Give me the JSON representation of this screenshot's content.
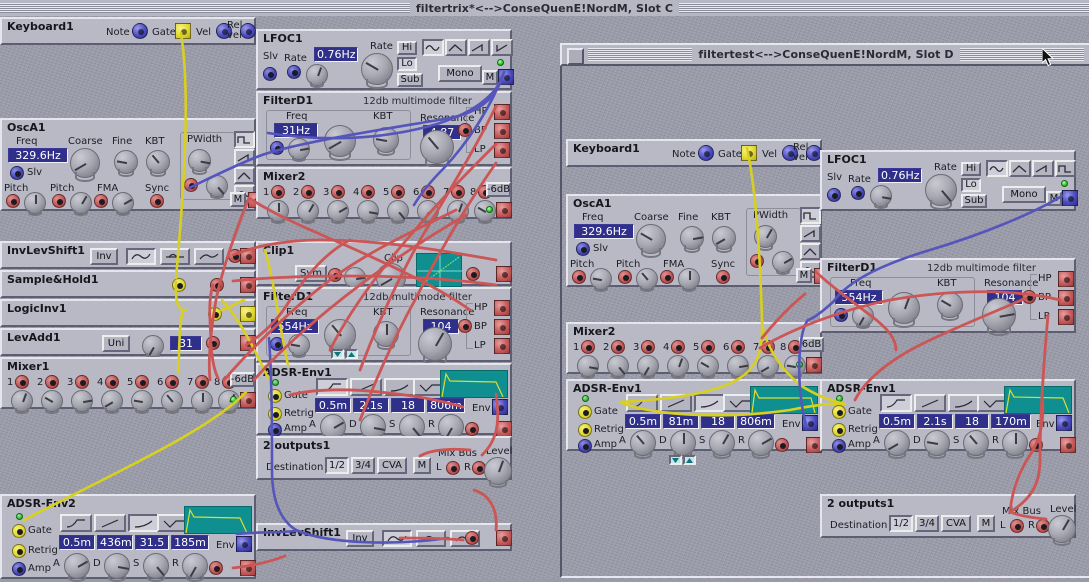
{
  "window_main": {
    "title": "filtertrix*<-->ConseQuenE!NordM, Slot C"
  },
  "window_sub": {
    "title": "filtertest<-->ConseQuenE!NordM, Slot D",
    "close_label": ""
  },
  "labels": {
    "note": "Note",
    "gate": "Gate",
    "vel": "Vel",
    "rel_vel": "Rel vel",
    "freq": "Freq",
    "coarse": "Coarse",
    "fine": "Fine",
    "kbt": "KBT",
    "pwidth": "PWidth",
    "pitch": "Pitch",
    "fma": "FMA",
    "sync": "Sync",
    "slv": "Slv",
    "rate": "Rate",
    "mono": "Mono",
    "m": "M",
    "hi": "Hi",
    "lo": "Lo",
    "sub": "Sub",
    "resonance": "Resonance",
    "hp": "HP",
    "bp": "BP",
    "lp": "LP",
    "filter_sub": "12db multimode filter",
    "minus6db": "-6dB",
    "plus6db": "6dB",
    "inv": "Inv",
    "uni": "Uni",
    "sym": "Sym",
    "clip": "Clip",
    "a": "A",
    "d": "D",
    "s": "S",
    "r": "R",
    "env": "Env",
    "retrig": "Retrig",
    "amp": "Amp",
    "destination": "Destination",
    "mix_bus": "Mix Bus",
    "level": "Level",
    "out_l": "L",
    "out_r": "R",
    "dest_12": "1/2",
    "dest_34": "3/4",
    "dest_cva": "CVA"
  },
  "left_panel": {
    "keyboard": {
      "name": "Keyboard1"
    },
    "osc": {
      "name": "OscA1",
      "freq": "329.6Hz"
    },
    "lfo": {
      "name": "LFOC1",
      "rate": "0.76Hz"
    },
    "filter_top": {
      "name": "FilterD1",
      "freq": "31Hz",
      "resonance": "4.87"
    },
    "mixer2": {
      "name": "Mixer2",
      "channels": [
        "1",
        "2",
        "3",
        "4",
        "5",
        "6",
        "7",
        "8"
      ]
    },
    "invlevshift1": {
      "name": "InvLevShift1"
    },
    "samplehold": {
      "name": "Sample&Hold1"
    },
    "logicinv": {
      "name": "LogicInv1"
    },
    "levadd": {
      "name": "LevAdd1",
      "value": "31"
    },
    "mixer1": {
      "name": "Mixer1",
      "channels": [
        "1",
        "2",
        "3",
        "4",
        "5",
        "6",
        "7",
        "8"
      ]
    },
    "clip": {
      "name": "Clip1"
    },
    "filter_bottom": {
      "name": "FilterD1",
      "freq": "554Hz",
      "resonance": "104"
    },
    "adsr1": {
      "name": "ADSR-Env1",
      "a": "0.5m",
      "d": "2.1s",
      "s": "18",
      "r": "806m"
    },
    "outputs": {
      "name": "2 outputs1"
    },
    "adsr2": {
      "name": "ADSR-Env2",
      "a": "0.5m",
      "d": "436m",
      "s": "31.5",
      "r": "185m"
    },
    "invlevshift2": {
      "name": "InvLevShift1"
    }
  },
  "right_panel": {
    "keyboard": {
      "name": "Keyboard1"
    },
    "osc": {
      "name": "OscA1",
      "freq": "329.6Hz"
    },
    "mixer2": {
      "name": "Mixer2",
      "channels": [
        "1",
        "2",
        "3",
        "4",
        "5",
        "6",
        "7",
        "8"
      ]
    },
    "adsr_left": {
      "name": "ADSR-Env1",
      "a": "0.5m",
      "d": "81m",
      "s": "18",
      "r": "806m"
    },
    "lfo": {
      "name": "LFOC1",
      "rate": "0.76Hz"
    },
    "filter": {
      "name": "FilterD1",
      "freq": "554Hz",
      "resonance": "104"
    },
    "adsr_right": {
      "name": "ADSR-Env1",
      "a": "0.5m",
      "d": "2.1s",
      "s": "18",
      "r": "170m"
    },
    "outputs": {
      "name": "2 outputs1"
    }
  },
  "colors": {
    "cable_red": "#cc5555",
    "cable_blue": "#5555bb",
    "cable_yellow": "#d8d020",
    "panel": "#b8b9c4",
    "display_bg": "#30308a",
    "env_bg": "#0f8f8f"
  }
}
